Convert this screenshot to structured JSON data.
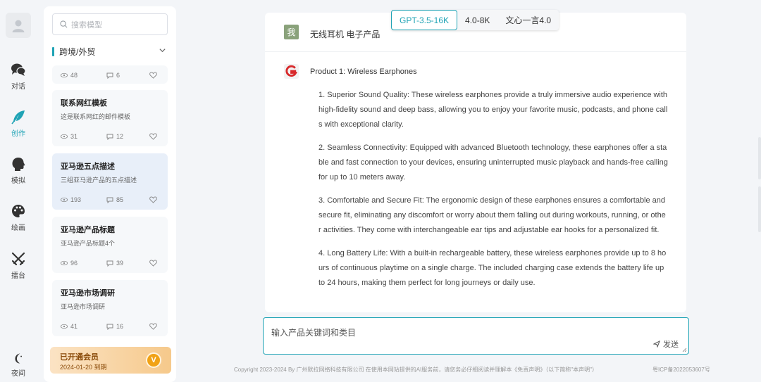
{
  "rail": {
    "items": [
      {
        "label": "对话",
        "icon": "chat-bubbles-icon"
      },
      {
        "label": "创作",
        "icon": "feather-icon"
      },
      {
        "label": "模拟",
        "icon": "head-profile-icon"
      },
      {
        "label": "绘画",
        "icon": "palette-icon"
      },
      {
        "label": "擂台",
        "icon": "crossed-swords-icon"
      }
    ],
    "night_label": "夜间",
    "active_color": "#1fa3b5"
  },
  "panel": {
    "search_placeholder": "搜索模型",
    "category": "跨境/外贸",
    "cards": [
      {
        "title": "",
        "desc": "",
        "views": "48",
        "comments": "6"
      },
      {
        "title": "联系网红模板",
        "desc": "这是联系网红的邮件模板",
        "views": "31",
        "comments": "12"
      },
      {
        "title": "亚马逊五点描述",
        "desc": "三组亚马逊产品的五点描述",
        "views": "193",
        "comments": "85"
      },
      {
        "title": "亚马逊产品标题",
        "desc": "亚马逊产品标题4个",
        "views": "96",
        "comments": "39"
      },
      {
        "title": "亚马逊市场调研",
        "desc": "亚马逊市场调研",
        "views": "41",
        "comments": "16"
      }
    ],
    "vip": {
      "title": "已开通会员",
      "date": "2024-01-20 到期",
      "badge": "V"
    }
  },
  "tabs": [
    "GPT-3.5-16K",
    "4.0-8K",
    "文心一言4.0"
  ],
  "chat": {
    "user_avatar": "我",
    "user_message": "无线耳机 电子产品",
    "bot_title": "Product 1: Wireless Earphones",
    "points": [
      "1. Superior Sound Quality: These wireless earphones provide a truly immersive audio experience with high-fidelity sound and deep bass, allowing you to enjoy your favorite music, podcasts, and phone calls with exceptional clarity.",
      "2. Seamless Connectivity: Equipped with advanced Bluetooth technology, these earphones offer a stable and fast connection to your devices, ensuring uninterrupted music playback and hands-free calling for up to 10 meters away.",
      "3. Comfortable and Secure Fit: The ergonomic design of these earphones ensures a comfortable and secure fit, eliminating any discomfort or worry about them falling out during workouts, running, or other activities. They come with interchangeable ear tips and adjustable ear hooks for a personalized fit.",
      "4. Long Battery Life: With a built-in rechargeable battery, these wireless earphones provide up to 8 hours of continuous playtime on a single charge. The included charging case extends the battery life up to 24 hours, making them perfect for long journeys or daily use."
    ]
  },
  "input": {
    "placeholder": "输入产品关键词和类目",
    "send_label": "发送"
  },
  "footer": {
    "copyright": "Copyright 2023-2024 By 广州默拉网络科技有限公司 在使用本网站提供的AI服务前，请您务必仔细阅读并理解本《免责声明》（以下简称\"本声明\"）",
    "icp": "粤ICP备2022053607号"
  }
}
